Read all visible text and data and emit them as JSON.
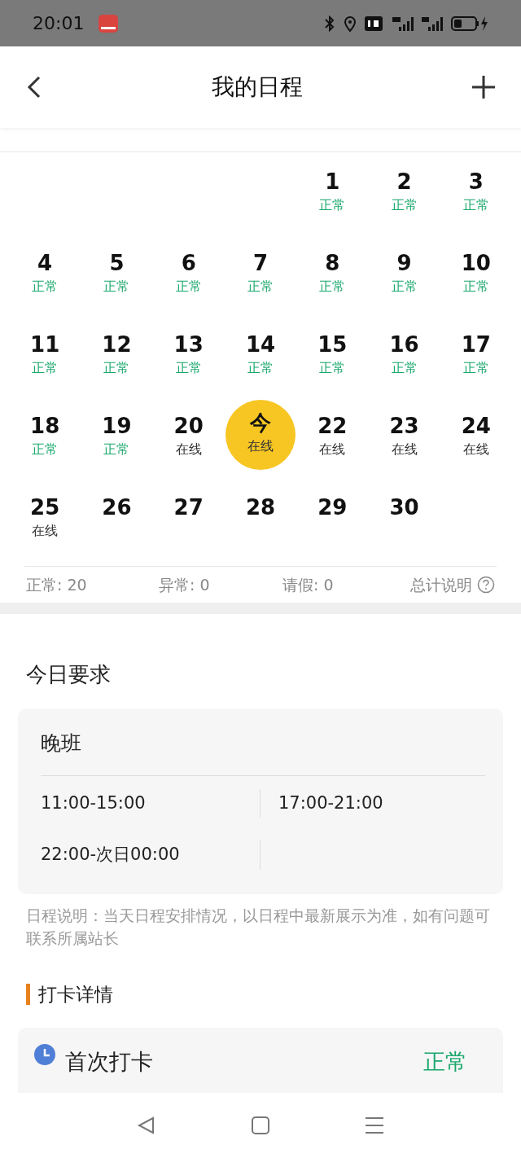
{
  "status_bar": {
    "time": "20:01"
  },
  "header": {
    "title": "我的日程"
  },
  "calendar": {
    "days": [
      {
        "day": "1",
        "status": "正常",
        "kind": "normal",
        "selected": false
      },
      {
        "day": "2",
        "status": "正常",
        "kind": "normal",
        "selected": false
      },
      {
        "day": "3",
        "status": "正常",
        "kind": "normal",
        "selected": false
      },
      {
        "day": "4",
        "status": "正常",
        "kind": "normal",
        "selected": false
      },
      {
        "day": "5",
        "status": "正常",
        "kind": "normal",
        "selected": false
      },
      {
        "day": "6",
        "status": "正常",
        "kind": "normal",
        "selected": false
      },
      {
        "day": "7",
        "status": "正常",
        "kind": "normal",
        "selected": false
      },
      {
        "day": "8",
        "status": "正常",
        "kind": "normal",
        "selected": false
      },
      {
        "day": "9",
        "status": "正常",
        "kind": "normal",
        "selected": false
      },
      {
        "day": "10",
        "status": "正常",
        "kind": "normal",
        "selected": false
      },
      {
        "day": "11",
        "status": "正常",
        "kind": "normal",
        "selected": false
      },
      {
        "day": "12",
        "status": "正常",
        "kind": "normal",
        "selected": false
      },
      {
        "day": "13",
        "status": "正常",
        "kind": "normal",
        "selected": false
      },
      {
        "day": "14",
        "status": "正常",
        "kind": "normal",
        "selected": false
      },
      {
        "day": "15",
        "status": "正常",
        "kind": "normal",
        "selected": false
      },
      {
        "day": "16",
        "status": "正常",
        "kind": "normal",
        "selected": false
      },
      {
        "day": "17",
        "status": "正常",
        "kind": "normal",
        "selected": false
      },
      {
        "day": "18",
        "status": "正常",
        "kind": "normal",
        "selected": false
      },
      {
        "day": "19",
        "status": "正常",
        "kind": "normal",
        "selected": false
      },
      {
        "day": "20",
        "status": "在线",
        "kind": "online",
        "selected": false
      },
      {
        "day": "今",
        "status": "在线",
        "kind": "online",
        "selected": true
      },
      {
        "day": "22",
        "status": "在线",
        "kind": "online",
        "selected": false
      },
      {
        "day": "23",
        "status": "在线",
        "kind": "online",
        "selected": false
      },
      {
        "day": "24",
        "status": "在线",
        "kind": "online",
        "selected": false
      },
      {
        "day": "25",
        "status": "在线",
        "kind": "online",
        "selected": false
      },
      {
        "day": "26",
        "selected": false
      },
      {
        "day": "27",
        "selected": false
      },
      {
        "day": "28",
        "selected": false
      },
      {
        "day": "29",
        "selected": false
      },
      {
        "day": "30",
        "selected": false
      }
    ]
  },
  "summary": [
    "正常: 20",
    "异常: 0",
    "请假: 0"
  ],
  "summary_help": "总计说明",
  "today": {
    "heading": "今日要求",
    "shift": "晚班",
    "times": [
      "11:00-15:00",
      "17:00-21:00",
      "22:00-次日00:00"
    ],
    "note": "日程说明：当天日程安排情况，以日程中最新展示为准，如有问题可联系所属站长"
  },
  "checkin": {
    "heading": "打卡详情",
    "items": [
      {
        "label": "首次打卡",
        "status": "正常",
        "kind": "normal"
      }
    ]
  }
}
